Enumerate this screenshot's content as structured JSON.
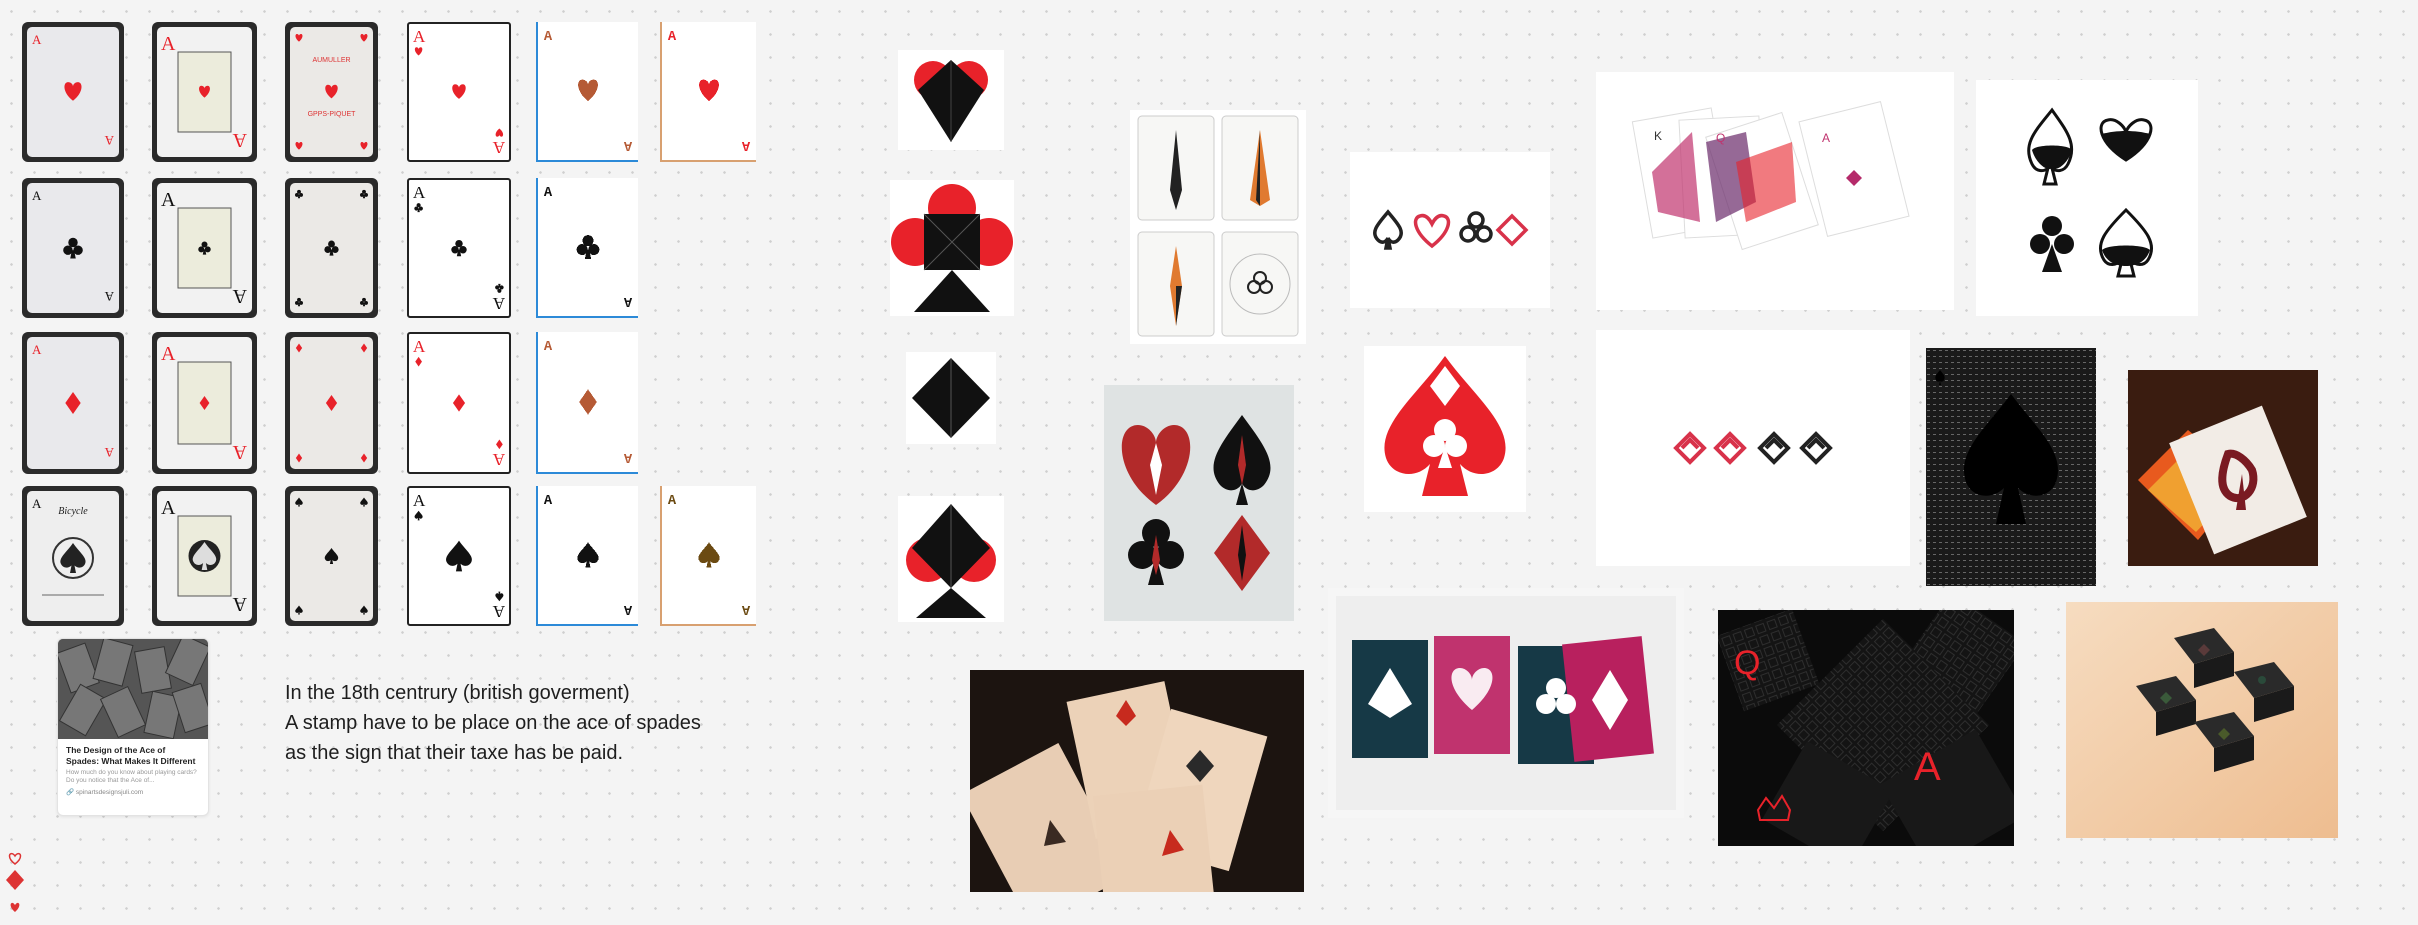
{
  "canvas": {
    "background": "#f4f4f4",
    "dot_color": "#cfcfcf"
  },
  "colors": {
    "red": "#e8222a",
    "black": "#111111",
    "pixel_red": "#b55a35",
    "accent_blue": "#2c8ad8"
  },
  "card_grid": {
    "ranks": {
      "ace": "A"
    },
    "print_labels": {
      "top": "AUMULLER",
      "bottom": "GPPS-PIQUET"
    },
    "rows": [
      {
        "suit": "heart",
        "color": "red"
      },
      {
        "suit": "club",
        "color": "black"
      },
      {
        "suit": "diamond",
        "color": "red"
      },
      {
        "suit": "spade",
        "color": "black"
      }
    ]
  },
  "bicycle_brand": "Bicycle",
  "link_card": {
    "title": "The Design of the Ace of Spades: What Makes It Different",
    "description": "How much do you know about playing cards? Do you notice that the Ace of...",
    "url": "spinartsdesignsjuli.com",
    "link_icon": "link-icon"
  },
  "note": {
    "lines": [
      "In the 18th centrury (british goverment)",
      "A stamp have to be place on the ace of spades as the sign that their taxe has be paid."
    ]
  },
  "moodboard": {
    "deck_letters": {
      "k": "K",
      "q": "Q",
      "a": "A"
    },
    "sidebar_icons": [
      "heart-icon",
      "diamond-icon",
      "heart-icon"
    ]
  }
}
